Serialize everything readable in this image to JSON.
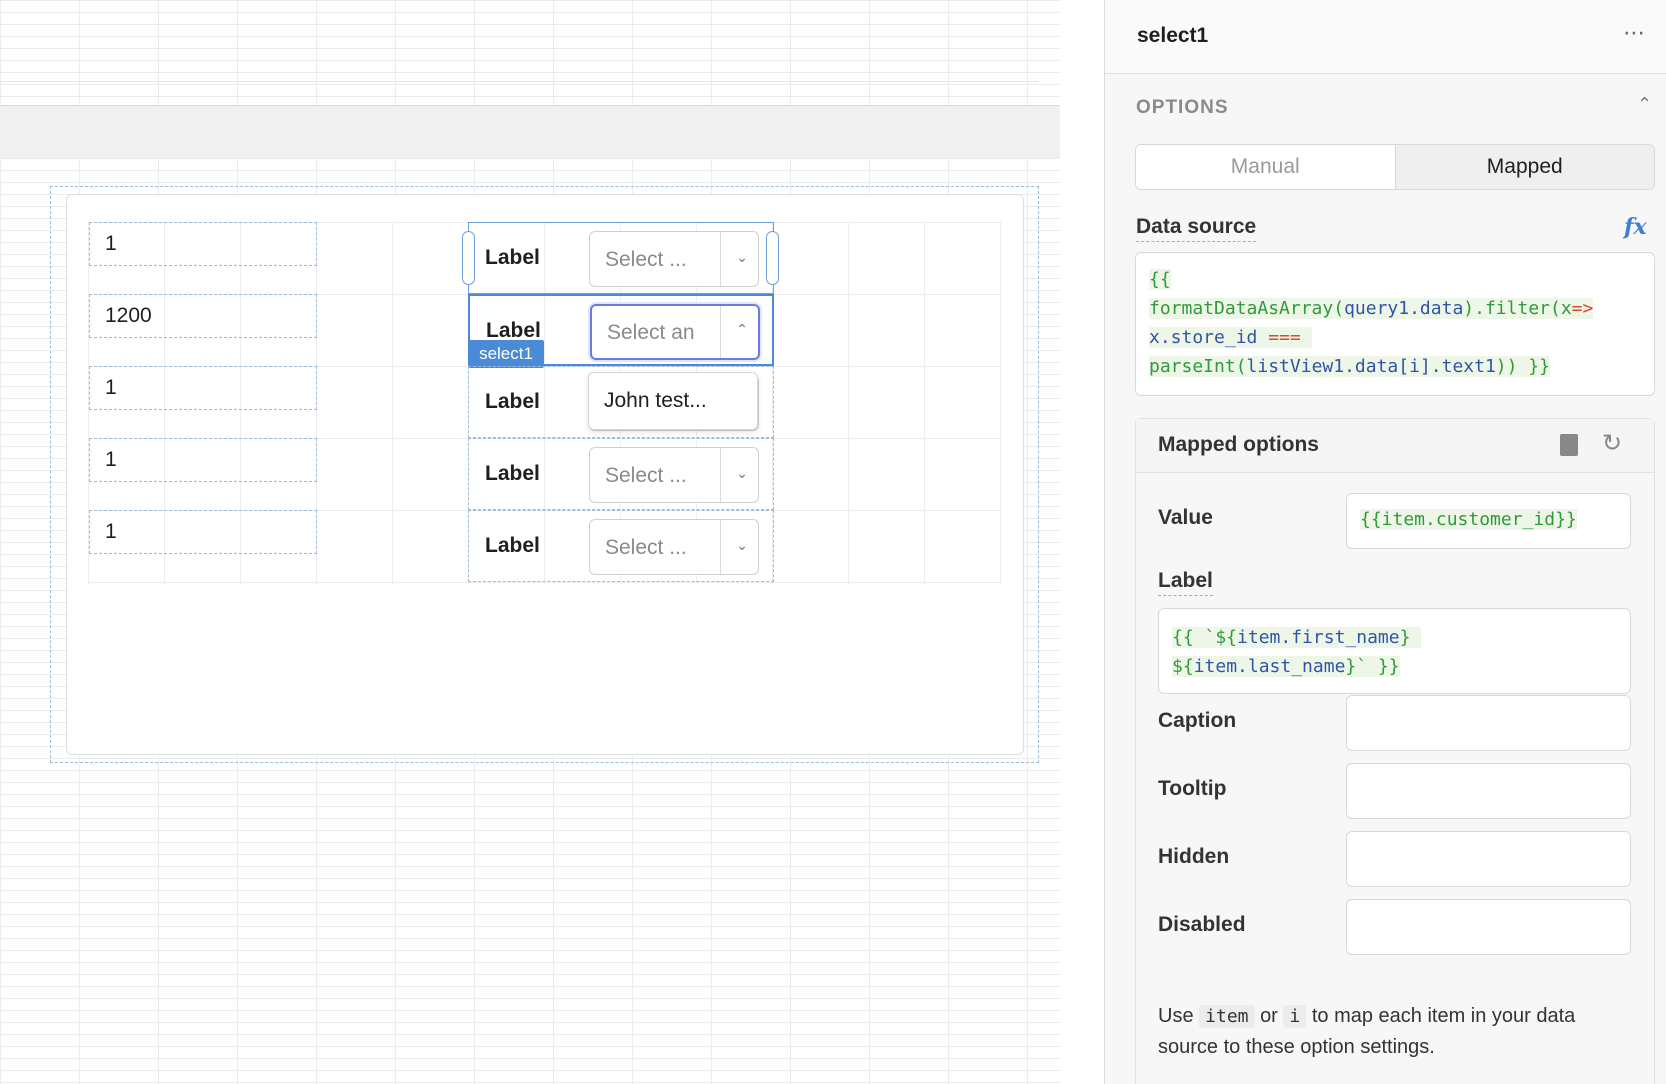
{
  "canvas": {
    "list_rows": [
      {
        "number": "1",
        "label": "Label",
        "select_placeholder": "Select ..."
      },
      {
        "number": "1200",
        "label": "Label",
        "select_placeholder": "Select an"
      },
      {
        "number": "1",
        "label": "Label",
        "select_placeholder": ""
      },
      {
        "number": "1",
        "label": "Label",
        "select_placeholder": "Select ..."
      },
      {
        "number": "1",
        "label": "Label",
        "select_placeholder": "Select ..."
      }
    ],
    "selected_component_tag": "select1",
    "dropdown_option": "John test..."
  },
  "inspector": {
    "component_name": "select1",
    "options_section_title": "OPTIONS",
    "mode_tabs": {
      "manual": "Manual",
      "mapped": "Mapped",
      "active": "Mapped"
    },
    "data_source": {
      "label": "Data source",
      "code_lines": [
        "{{",
        "formatDataAsArray(query1.data).filter(x=>",
        "x.store_id ===",
        "parseInt(listView1.data[i].text1)) }}"
      ]
    },
    "mapped_options": {
      "title": "Mapped options",
      "value_label": "Value",
      "value": "{{item.customer_id}}",
      "label_label": "Label",
      "label_code_lines": [
        "{{ `${item.first_name}",
        "${item.last_name}` }}"
      ],
      "caption_label": "Caption",
      "tooltip_label": "Tooltip",
      "hidden_label": "Hidden",
      "disabled_label": "Disabled",
      "hint": {
        "pre": "Use",
        "code1": "item",
        "mid": "or",
        "code2": "i",
        "post": "to map each item in your data source to these option settings."
      }
    }
  },
  "colors": {
    "selection_blue": "#4a8ad6",
    "focus_purple": "#6b7cde",
    "code_green": "#2e9b39",
    "code_blue": "#2f55a8",
    "code_red": "#d24c2f"
  }
}
